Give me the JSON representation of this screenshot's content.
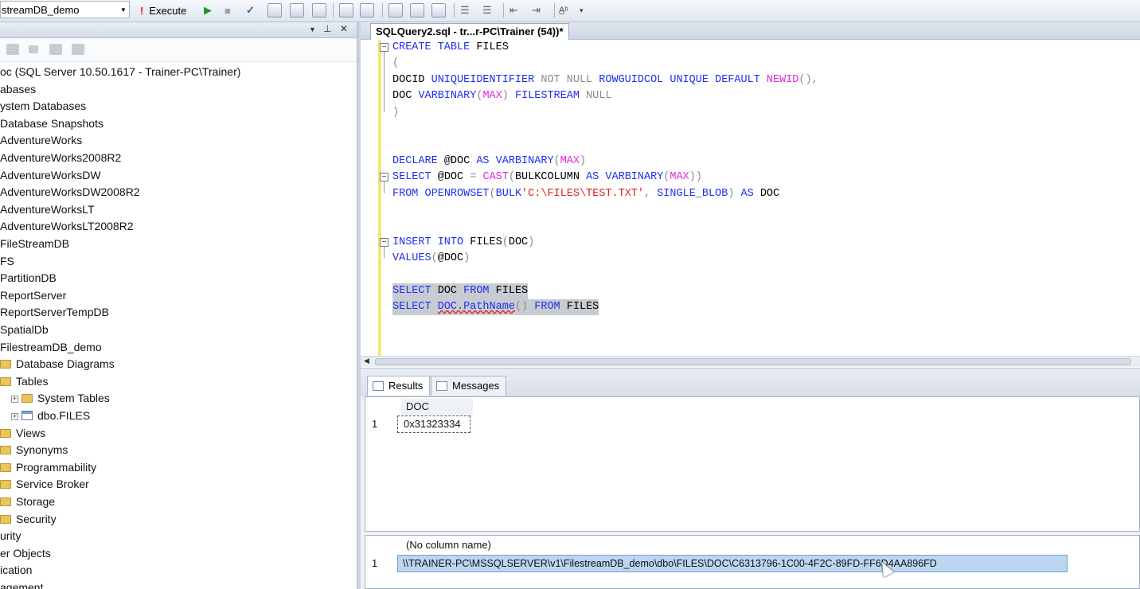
{
  "toolbar": {
    "database": "streamDB_demo",
    "execute_label": "Execute"
  },
  "explorer": {
    "nodes": [
      "oc (SQL Server 10.50.1617 - Trainer-PC\\Trainer)",
      "abases",
      "ystem Databases",
      "Database Snapshots",
      "AdventureWorks",
      "AdventureWorks2008R2",
      "AdventureWorksDW",
      "AdventureWorksDW2008R2",
      "AdventureWorksLT",
      "AdventureWorksLT2008R2",
      "FileStreamDB",
      "FS",
      "PartitionDB",
      "ReportServer",
      "ReportServerTempDB",
      "SpatialDb",
      "FilestreamDB_demo",
      "Database Diagrams",
      "Tables",
      "System Tables",
      "dbo.FILES",
      "Views",
      "Synonyms",
      "Programmability",
      "Service Broker",
      "Storage",
      "Security",
      "urity",
      "er Objects",
      "ication",
      "agement"
    ]
  },
  "editor": {
    "tab_title": "SQLQuery2.sql - tr...r-PC\\Trainer (54))*",
    "lines": [
      {
        "t": [
          [
            "CREATE TABLE ",
            "kw"
          ],
          [
            "FILES",
            ""
          ]
        ]
      },
      {
        "t": [
          [
            "(",
            "gr"
          ]
        ]
      },
      {
        "t": [
          [
            "DOCID ",
            ""
          ],
          [
            "UNIQUEIDENTIFIER ",
            "kw"
          ],
          [
            "NOT NULL ",
            "gr"
          ],
          [
            "ROWGUIDCOL UNIQUE DEFAULT ",
            "kw"
          ],
          [
            "NEWID",
            "fn"
          ],
          [
            "(),",
            "gr"
          ]
        ]
      },
      {
        "t": [
          [
            "DOC ",
            ""
          ],
          [
            "VARBINARY",
            "kw"
          ],
          [
            "(",
            "gr"
          ],
          [
            "MAX",
            "fn"
          ],
          [
            ") ",
            "gr"
          ],
          [
            "FILESTREAM ",
            "kw"
          ],
          [
            "NULL",
            "gr"
          ]
        ]
      },
      {
        "t": [
          [
            ")",
            "gr"
          ]
        ]
      },
      {
        "t": []
      },
      {
        "t": []
      },
      {
        "t": [
          [
            "DECLARE ",
            "kw"
          ],
          [
            "@DOC ",
            ""
          ],
          [
            "AS ",
            "kw"
          ],
          [
            "VARBINARY",
            "kw"
          ],
          [
            "(",
            "gr"
          ],
          [
            "MAX",
            "fn"
          ],
          [
            ")",
            "gr"
          ]
        ]
      },
      {
        "t": [
          [
            "SELECT ",
            "kw"
          ],
          [
            "@DOC ",
            ""
          ],
          [
            "= ",
            "gr"
          ],
          [
            "CAST",
            "fn"
          ],
          [
            "(",
            "gr"
          ],
          [
            "BULKCOLUMN ",
            ""
          ],
          [
            "AS ",
            "kw"
          ],
          [
            "VARBINARY",
            "kw"
          ],
          [
            "(",
            "gr"
          ],
          [
            "MAX",
            "fn"
          ],
          [
            "))",
            "gr"
          ]
        ]
      },
      {
        "t": [
          [
            "FROM ",
            "kw"
          ],
          [
            "OPENROWSET",
            "kw"
          ],
          [
            "(",
            "gr"
          ],
          [
            "BULK",
            "kw"
          ],
          [
            "'C:\\FILES\\TEST.TXT'",
            "st"
          ],
          [
            ", ",
            "gr"
          ],
          [
            "SINGLE_BLOB",
            "kw"
          ],
          [
            ") ",
            "gr"
          ],
          [
            "AS ",
            "kw"
          ],
          [
            "DOC",
            ""
          ]
        ]
      },
      {
        "t": []
      },
      {
        "t": []
      },
      {
        "t": [
          [
            "INSERT INTO ",
            "kw"
          ],
          [
            "FILES",
            ""
          ],
          [
            "(",
            "gr"
          ],
          [
            "DOC",
            ""
          ],
          [
            ")",
            "gr"
          ]
        ]
      },
      {
        "t": [
          [
            "VALUES",
            "kw"
          ],
          [
            "(",
            "gr"
          ],
          [
            "@DOC",
            ""
          ],
          [
            ")",
            "gr"
          ]
        ]
      },
      {
        "t": []
      },
      {
        "t": [
          [
            "SELECT ",
            "kw"
          ],
          [
            "DOC ",
            ""
          ],
          [
            "FROM ",
            "kw"
          ],
          [
            "FILES",
            ""
          ]
        ]
      },
      {
        "t": [
          [
            "SELECT ",
            "kw"
          ],
          [
            "DOC.PathName",
            "sq"
          ],
          [
            "() ",
            "gr"
          ],
          [
            "FROM ",
            "kw"
          ],
          [
            "FILES",
            ""
          ]
        ]
      }
    ]
  },
  "results": {
    "tabs": [
      "Results",
      "Messages"
    ],
    "grid1": {
      "header": "DOC",
      "row_num": "1",
      "value": "0x31323334"
    },
    "grid2": {
      "header": "(No column name)",
      "row_num": "1",
      "value": "\\\\TRAINER-PC\\MSSQLSERVER\\v1\\FilestreamDB_demo\\dbo\\FILES\\DOC\\C6313796-1C00-4F2C-89FD-FF6D4AA896FD"
    }
  }
}
